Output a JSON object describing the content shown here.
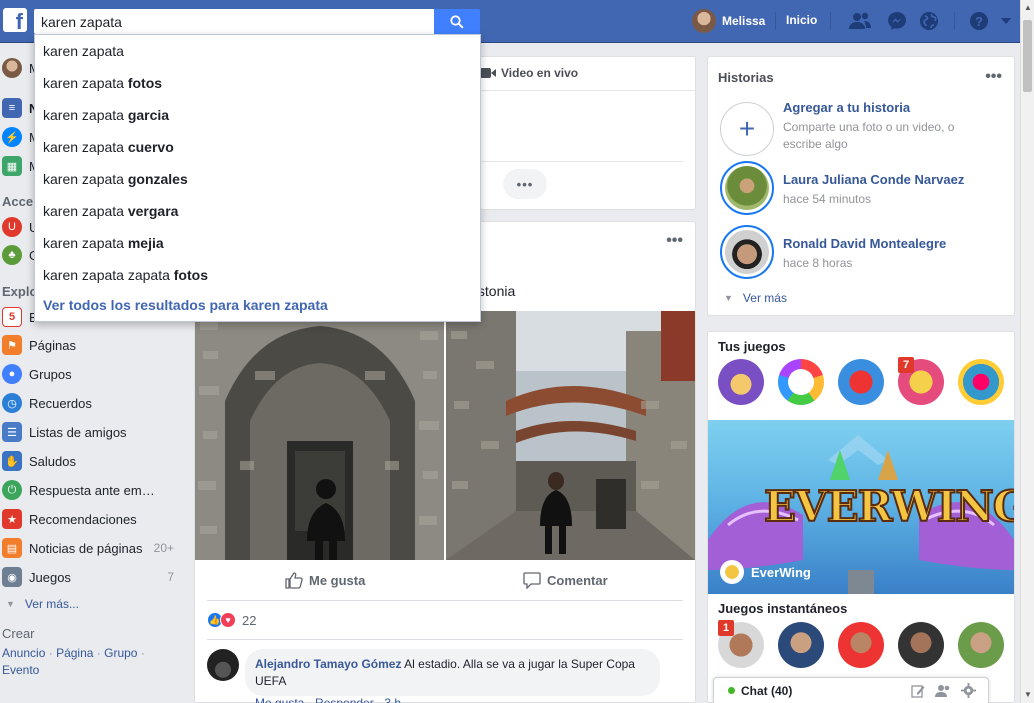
{
  "topbar": {
    "logo": "f",
    "search_value": "karen zapata",
    "user_name": "Melissa",
    "home_label": "Inicio",
    "icons": [
      "friends-icon",
      "messenger-icon",
      "globe-icon",
      "help-icon",
      "dropdown-icon"
    ]
  },
  "search_suggestions": {
    "items": [
      {
        "prefix": "karen zapata",
        "suffix": ""
      },
      {
        "prefix": "karen zapata ",
        "suffix": "fotos"
      },
      {
        "prefix": "karen zapata ",
        "suffix": "garcia"
      },
      {
        "prefix": "karen zapata ",
        "suffix": "cuervo"
      },
      {
        "prefix": "karen zapata ",
        "suffix": "gonzales"
      },
      {
        "prefix": "karen zapata ",
        "suffix": "vergara"
      },
      {
        "prefix": "karen zapata ",
        "suffix": "mejia"
      },
      {
        "prefix": "karen zapata zapata ",
        "suffix": "fotos"
      }
    ],
    "see_all": "Ver todos los resultados para karen zapata"
  },
  "sidebar": {
    "profile_initial": "M",
    "top_items": [
      "N",
      "M",
      "M"
    ],
    "section_shortcuts": "Acce",
    "shortcut_items": [
      "U",
      "G"
    ],
    "section_explore": "Explo",
    "explore_first": "E",
    "items": [
      {
        "label": "Páginas",
        "count": ""
      },
      {
        "label": "Grupos",
        "count": ""
      },
      {
        "label": "Recuerdos",
        "count": ""
      },
      {
        "label": "Listas de amigos",
        "count": ""
      },
      {
        "label": "Saludos",
        "count": ""
      },
      {
        "label": "Respuesta ante em…",
        "count": ""
      },
      {
        "label": "Recomendaciones",
        "count": ""
      },
      {
        "label": "Noticias de páginas",
        "count": "20+"
      },
      {
        "label": "Juegos",
        "count": "7"
      }
    ],
    "see_more": "Ver más...",
    "create_heading": "Crear",
    "create_links": [
      "Anuncio",
      "Página",
      "Grupo",
      "Evento"
    ]
  },
  "composer": {
    "live_video": "Video en vivo"
  },
  "post": {
    "location": "n, Estonia",
    "like_label": "Me gusta",
    "comment_label": "Comentar",
    "reaction_count": "22",
    "comment": {
      "author": "Alejandro Tamayo Gómez",
      "text": " Al estadio. Alla se va a jugar la Super Copa UEFA",
      "footer": "Me gusta · Responder · 3 h"
    }
  },
  "stories": {
    "title": "Historias",
    "add_title": "Agregar a tu historia",
    "add_sub": "Comparte una foto o un video, o escribe algo",
    "items": [
      {
        "name": "Laura Juliana Conde Narvaez",
        "time": "hace 54 minutos"
      },
      {
        "name": "Ronald David Montealegre",
        "time": "hace 8 horas"
      }
    ],
    "see_more": "Ver más"
  },
  "games": {
    "title": "Tus juegos",
    "badge": "7",
    "banner_title": "EVERWING",
    "banner_label": "EverWing",
    "instant_title": "Juegos instantáneos",
    "instant_badge": "1"
  },
  "chat": {
    "label": "Chat (40)"
  },
  "colors": {
    "brand": "#4267b2",
    "link": "#365899",
    "story_ring": "#1877f2"
  }
}
